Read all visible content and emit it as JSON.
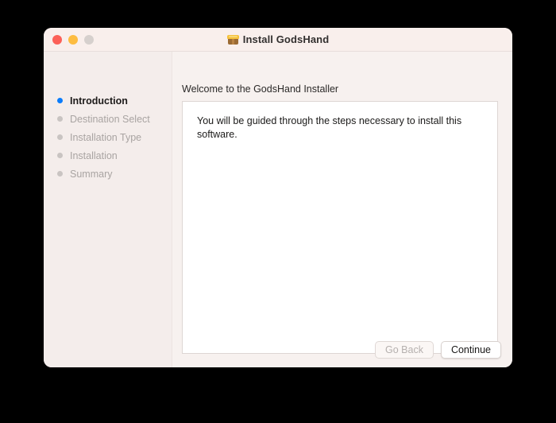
{
  "window": {
    "title": "Install GodsHand",
    "title_icon": "package-icon",
    "traffic_lights": [
      {
        "name": "close",
        "color": "#fc6058"
      },
      {
        "name": "minimize",
        "color": "#fdbc40"
      },
      {
        "name": "zoom",
        "color": "#d6d0cd"
      }
    ]
  },
  "sidebar": {
    "steps": [
      {
        "label": "Introduction",
        "state": "active"
      },
      {
        "label": "Destination Select",
        "state": "pending"
      },
      {
        "label": "Installation Type",
        "state": "pending"
      },
      {
        "label": "Installation",
        "state": "pending"
      },
      {
        "label": "Summary",
        "state": "pending"
      }
    ],
    "active_dot_color": "#0a7cfb",
    "pending_dot_color": "#c9c4c2"
  },
  "main": {
    "heading": "Welcome to the GodsHand Installer",
    "body_text": "You will be guided through the steps necessary to install this software."
  },
  "footer": {
    "go_back_label": "Go Back",
    "continue_label": "Continue"
  }
}
